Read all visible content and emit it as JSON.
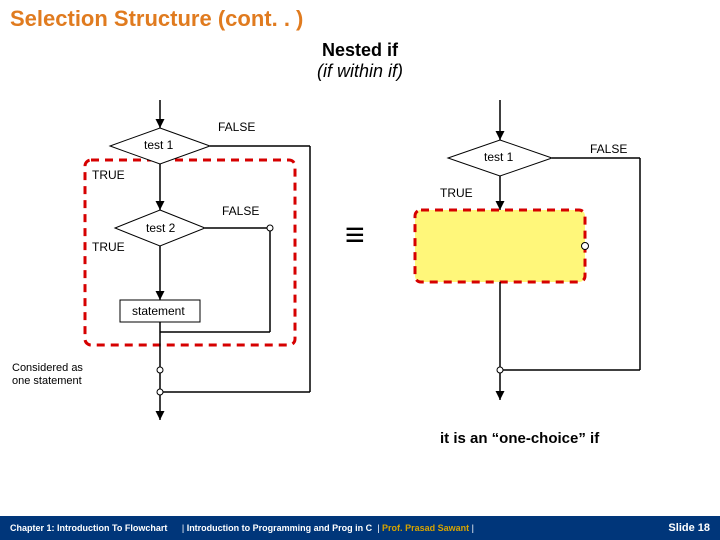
{
  "title": "Selection Structure (cont. . )",
  "subtitle1": "Nested if",
  "subtitle2": "(if within if)",
  "labels": {
    "false": "FALSE",
    "true": "TRUE",
    "test1": "test 1",
    "test2": "test 2",
    "statement": "statement"
  },
  "captions": {
    "considered": "Considered as\none statement",
    "onechoice": "it is an “one-choice” if"
  },
  "equiv": "≡",
  "footer": {
    "chapter": "Chapter 1: Introduction To Flowchart",
    "course": "Introduction to Programming and Prog in C",
    "proflabel": "Prof.",
    "profname": "Prasad Sawant",
    "slide": "Slide 18"
  }
}
